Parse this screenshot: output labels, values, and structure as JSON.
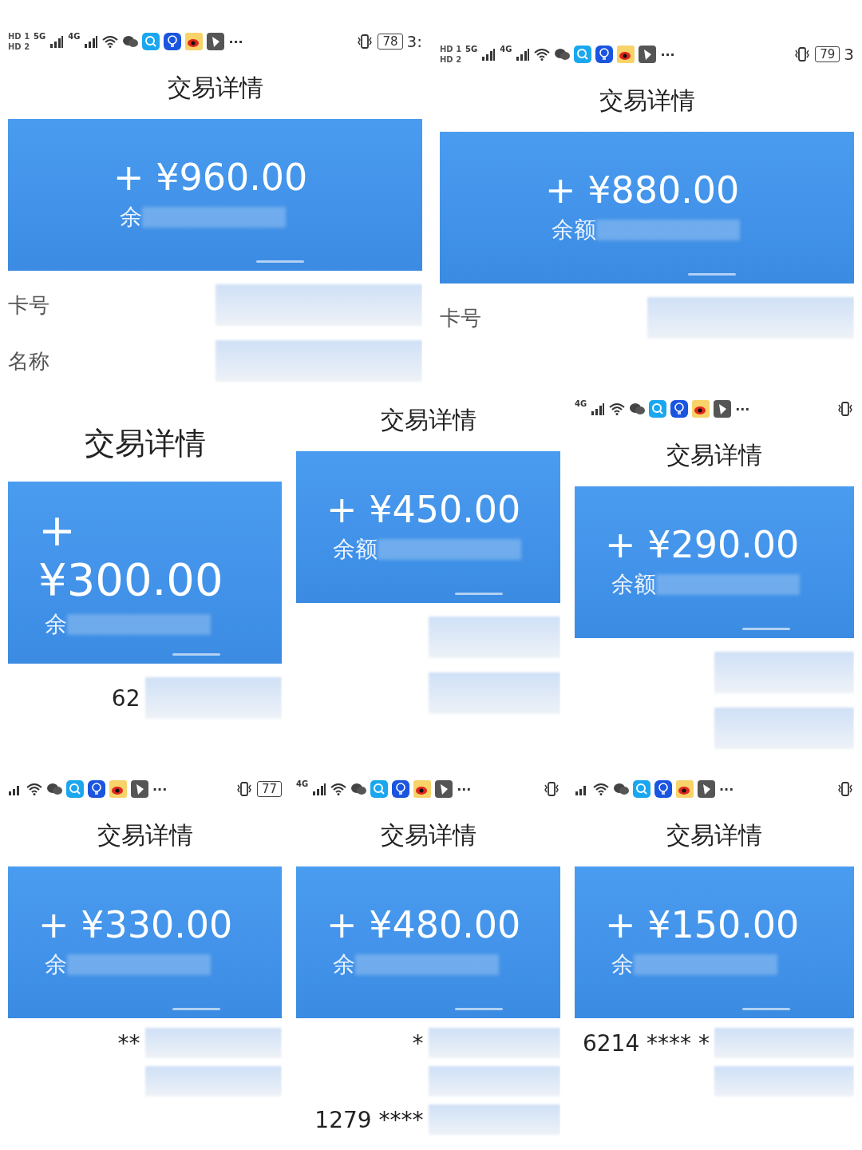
{
  "panels": [
    {
      "status_bar": {
        "sims": [
          "HD 1",
          "HD 2"
        ],
        "network": [
          "5G",
          "4G"
        ],
        "more": "···",
        "battery": "78",
        "time": "3:"
      },
      "title": "交易详情",
      "amount": "+ ¥960.00",
      "balance_label": "余",
      "rows": [
        {
          "label": "卡号"
        },
        {
          "label": "名称"
        }
      ]
    },
    {
      "status_bar": {
        "sims": [
          "HD 1",
          "HD 2"
        ],
        "network": [
          "5G",
          "4G"
        ],
        "more": "···",
        "battery": "79",
        "time": "3"
      },
      "title": "交易详情",
      "amount": "+ ¥880.00",
      "balance_label": "余额",
      "rows": [
        {
          "label": "卡号"
        }
      ]
    },
    {
      "title": "交易详情",
      "amount": "+ ¥300.00",
      "balance_label": "余",
      "rows": [
        {
          "value": "62"
        }
      ]
    },
    {
      "title": "交易详情",
      "amount": "+ ¥450.00",
      "balance_label": "余额",
      "rows": [
        {},
        {}
      ]
    },
    {
      "status_bar": {
        "network": [
          "4G"
        ],
        "more": "···"
      },
      "title": "交易详情",
      "amount": "+ ¥290.00",
      "balance_label": "余额",
      "rows": [
        {},
        {}
      ]
    },
    {
      "status_bar": {
        "more": "···",
        "battery": "77"
      },
      "title": "交易详情",
      "amount": "+ ¥330.00",
      "balance_label": "余",
      "rows": [
        {
          "value": "**"
        },
        {}
      ]
    },
    {
      "status_bar": {
        "network": [
          "4G"
        ],
        "more": "···"
      },
      "title": "交易详情",
      "amount": "+ ¥480.00",
      "balance_label": "余",
      "rows": [
        {
          "value": "*"
        },
        {},
        {
          "value": "1279 ****"
        }
      ]
    },
    {
      "status_bar": {
        "more": "···"
      },
      "title": "交易详情",
      "amount": "+ ¥150.00",
      "balance_label": "余",
      "rows": [
        {
          "value": "6214 **** *"
        },
        {}
      ]
    }
  ]
}
